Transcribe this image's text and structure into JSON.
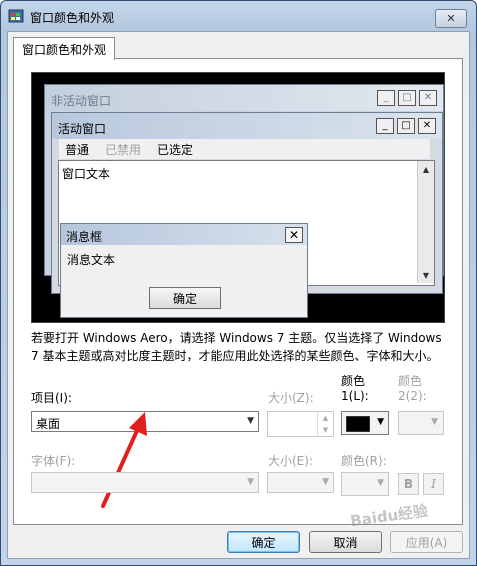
{
  "window": {
    "title": "窗口颜色和外观",
    "close_symbol": "✕"
  },
  "tab": {
    "label": "窗口颜色和外观"
  },
  "preview": {
    "inactive_window_title": "非活动窗口",
    "active_window_title": "活动窗口",
    "caption_buttons": [
      "_",
      "□",
      "✕"
    ],
    "menu_items": [
      {
        "label": "普通",
        "state": "normal"
      },
      {
        "label": "已禁用",
        "state": "disabled"
      },
      {
        "label": "已选定",
        "state": "selected"
      }
    ],
    "window_text": "窗口文本",
    "message_box_title": "消息框",
    "message_text": "消息文本",
    "message_ok": "确定"
  },
  "description": "若要打开 Windows Aero，请选择 Windows 7 主题。仅当选择了 Windows 7 基本主题或高对比度主题时，才能应用此处选择的某些颜色、字体和大小。",
  "item": {
    "label": "项目(I):",
    "value": "桌面"
  },
  "size1": {
    "label": "大小(Z):"
  },
  "color1": {
    "label_line1": "颜色",
    "label_line2": "1(L):",
    "value": "#000000"
  },
  "color2": {
    "label_line1": "颜色",
    "label_line2": "2(2):"
  },
  "font": {
    "label": "字体(F):"
  },
  "size2": {
    "label": "大小(E):"
  },
  "color3": {
    "label": "颜色(R):"
  },
  "bold_label": "B",
  "italic_label": "I",
  "buttons": {
    "ok": "确定",
    "cancel": "取消",
    "apply": "应用(A)"
  },
  "watermark": "Baidu经验",
  "colors": {
    "accent_arrow": "#e02020",
    "frame": "#b8cbe0"
  }
}
